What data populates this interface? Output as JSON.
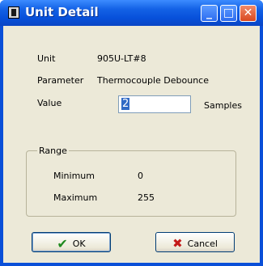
{
  "window": {
    "title": "Unit Detail"
  },
  "fields": {
    "unit_label": "Unit",
    "unit_value": "905U-LT#8",
    "parameter_label": "Parameter",
    "parameter_value": "Thermocouple Debounce",
    "value_label": "Value",
    "value_input": "2",
    "value_units": "Samples"
  },
  "range": {
    "title": "Range",
    "minimum_label": "Minimum",
    "minimum_value": "0",
    "maximum_label": "Maximum",
    "maximum_value": "255"
  },
  "buttons": {
    "ok_label": "OK",
    "cancel_label": "Cancel"
  },
  "icons": {
    "ok": "checkmark-icon",
    "cancel": "x-icon"
  },
  "colors": {
    "titlebar": "#0750da",
    "dialog_bg": "#ece9d8",
    "selection": "#316ac5"
  }
}
